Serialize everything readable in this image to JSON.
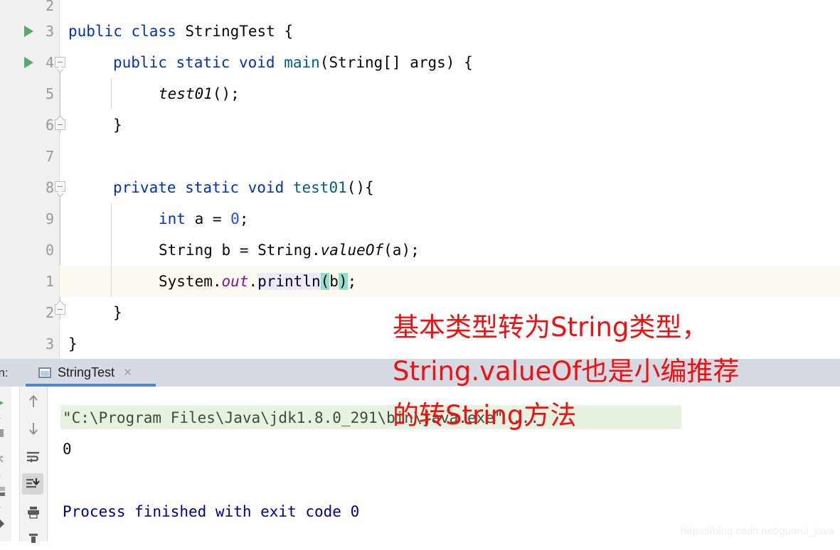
{
  "editor": {
    "lines": [
      {
        "num": "2",
        "text": "",
        "current": false,
        "runmark": false
      },
      {
        "num": "3",
        "text": "public class StringTest {",
        "current": false,
        "runmark": true
      },
      {
        "num": "4",
        "text": "public static void main(String[] args) {",
        "current": false,
        "runmark": true
      },
      {
        "num": "5",
        "text": "test01();",
        "current": false,
        "runmark": false
      },
      {
        "num": "6",
        "text": "}",
        "current": false,
        "runmark": false
      },
      {
        "num": "7",
        "text": "",
        "current": false,
        "runmark": false
      },
      {
        "num": "8",
        "text": "private static void test01(){",
        "current": false,
        "runmark": false
      },
      {
        "num": "9",
        "text": "int a = 0;",
        "current": false,
        "runmark": false
      },
      {
        "num": "0",
        "text": "String b = String.valueOf(a);",
        "current": false,
        "runmark": false
      },
      {
        "num": "1",
        "text": "System.out.println(b);",
        "current": true,
        "runmark": false
      },
      {
        "num": "2",
        "text": "}",
        "current": false,
        "runmark": false
      },
      {
        "num": "3",
        "text": "}",
        "current": false,
        "runmark": false
      }
    ],
    "class_name": "StringTest",
    "method_main": "main",
    "method_test01": "test01",
    "variable_a": "a",
    "variable_b": "b",
    "literal_zero": "0"
  },
  "run_panel": {
    "run_label": "un:",
    "tab_name": "StringTest",
    "tab_close": "×",
    "toolbar_left": [
      {
        "name": "rerun-icon",
        "glyph": "▶"
      },
      {
        "name": "stop-icon",
        "glyph": "■"
      },
      {
        "name": "restart-icon",
        "glyph": "↺"
      },
      {
        "name": "layout-icon",
        "glyph": "▤"
      },
      {
        "name": "pin-icon",
        "glyph": "◆"
      }
    ],
    "toolbar_right": [
      {
        "name": "up-arrow-icon",
        "glyph": "↑"
      },
      {
        "name": "down-arrow-icon",
        "glyph": "↓"
      },
      {
        "name": "soft-wrap-icon",
        "glyph": "↵"
      },
      {
        "name": "scroll-to-end-icon",
        "glyph": "↓"
      },
      {
        "name": "print-icon",
        "glyph": "⎙"
      },
      {
        "name": "clear-all-icon",
        "glyph": "⌧"
      }
    ],
    "console": {
      "command_line": "\"C:\\Program Files\\Java\\jdk1.8.0_291\\bin\\java.exe\" ...",
      "output": "0",
      "exit_line": "Process finished with exit code 0"
    }
  },
  "annotation": {
    "line1": "基本类型转为String类型，",
    "line2": "String.valueOf也是小编推荐",
    "line3": "的转String方法",
    "color": "#f01010"
  },
  "watermark": "https://blog.csdn.net/guorui_java",
  "colors": {
    "keyword": "#0033b3",
    "method": "#00627a",
    "number": "#1750eb",
    "static_field": "#871094",
    "current_line_bg": "#fcfaf0",
    "brace_match": "#93e0d0",
    "identifier_hl": "#ece9fc",
    "console_cmd_bg": "#e7f2e1",
    "tabstrip_bg": "#d6dae2",
    "tab_underline": "#4a88c7",
    "run_marker": "#59a869"
  }
}
